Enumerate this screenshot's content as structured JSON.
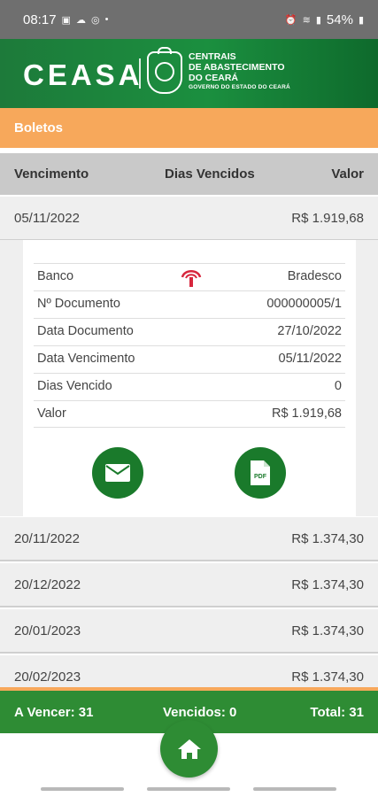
{
  "status": {
    "time": "08:17",
    "battery": "54%"
  },
  "header": {
    "logo": "CEASA",
    "tagline_1": "CENTRAIS",
    "tagline_2": "DE ABASTECIMENTO",
    "tagline_3": "DO CEARÁ",
    "tagline_4": "GOVERNO DO ESTADO DO CEARÁ"
  },
  "section_title": "Boletos",
  "table": {
    "col_1": "Vencimento",
    "col_2": "Dias Vencidos",
    "col_3": "Valor"
  },
  "rows": [
    {
      "date": "05/11/2022",
      "amount": "R$ 1.919,68"
    },
    {
      "date": "20/11/2022",
      "amount": "R$ 1.374,30"
    },
    {
      "date": "20/12/2022",
      "amount": "R$ 1.374,30"
    },
    {
      "date": "20/01/2023",
      "amount": "R$ 1.374,30"
    },
    {
      "date": "20/02/2023",
      "amount": "R$ 1.374,30"
    }
  ],
  "detail": {
    "fields": [
      {
        "label": "Banco",
        "value": "Bradesco"
      },
      {
        "label": "Nº Documento",
        "value": "000000005/1"
      },
      {
        "label": "Data Documento",
        "value": "27/10/2022"
      },
      {
        "label": "Data Vencimento",
        "value": "05/11/2022"
      },
      {
        "label": "Dias Vencido",
        "value": "0"
      },
      {
        "label": "Valor",
        "value": "R$ 1.919,68"
      }
    ],
    "email_icon": "envelope-icon",
    "pdf_icon": "pdf-file-icon",
    "pdf_icon_label": "PDF"
  },
  "summary": {
    "a_vencer": "A Vencer: 31",
    "vencidos": "Vencidos: 0",
    "total": "Total: 31"
  },
  "colors": {
    "green": "#1a7a2b",
    "orange": "#f7a85b",
    "gray_header": "#c9c9c9"
  }
}
